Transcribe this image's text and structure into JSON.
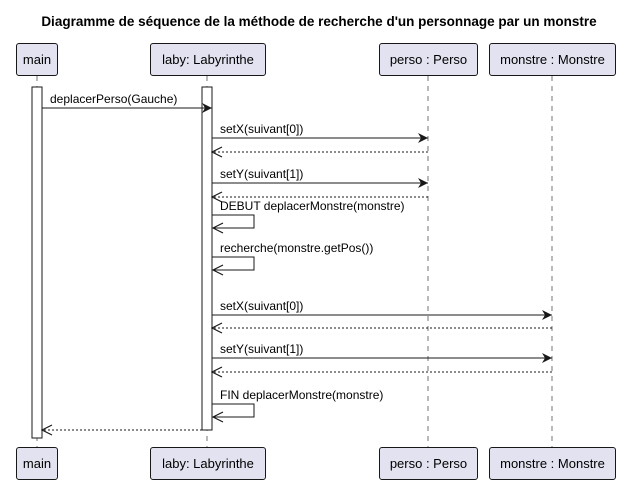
{
  "title": "Diagramme de séquence de la méthode de recherche d'un personnage par un monstre",
  "participants": [
    {
      "id": "main",
      "label": "main"
    },
    {
      "id": "laby",
      "label": "laby: Labyrinthe"
    },
    {
      "id": "perso",
      "label": "perso : Perso"
    },
    {
      "id": "monstre",
      "label": "monstre : Monstre"
    }
  ],
  "messages": [
    {
      "from": "main",
      "to": "laby",
      "label": "deplacerPerso(Gauche)",
      "kind": "call"
    },
    {
      "from": "laby",
      "to": "perso",
      "label": "setX(suivant[0])",
      "kind": "call"
    },
    {
      "from": "perso",
      "to": "laby",
      "label": "",
      "kind": "return"
    },
    {
      "from": "laby",
      "to": "perso",
      "label": "setY(suivant[1])",
      "kind": "call"
    },
    {
      "from": "perso",
      "to": "laby",
      "label": "",
      "kind": "return"
    },
    {
      "from": "laby",
      "to": "laby",
      "label": "DEBUT deplacerMonstre(monstre)",
      "kind": "self"
    },
    {
      "from": "laby",
      "to": "laby",
      "label": "recherche(monstre.getPos())",
      "kind": "self"
    },
    {
      "from": "laby",
      "to": "monstre",
      "label": "setX(suivant[0])",
      "kind": "call"
    },
    {
      "from": "monstre",
      "to": "laby",
      "label": "",
      "kind": "return"
    },
    {
      "from": "laby",
      "to": "monstre",
      "label": "setY(suivant[1])",
      "kind": "call"
    },
    {
      "from": "monstre",
      "to": "laby",
      "label": "",
      "kind": "return"
    },
    {
      "from": "laby",
      "to": "laby",
      "label": "FIN deplacerMonstre(monstre)",
      "kind": "self"
    },
    {
      "from": "laby",
      "to": "main",
      "label": "",
      "kind": "return"
    }
  ],
  "colors": {
    "participant_fill": "#e2e2f0",
    "line": "#181818",
    "lifeline": "#181818"
  }
}
